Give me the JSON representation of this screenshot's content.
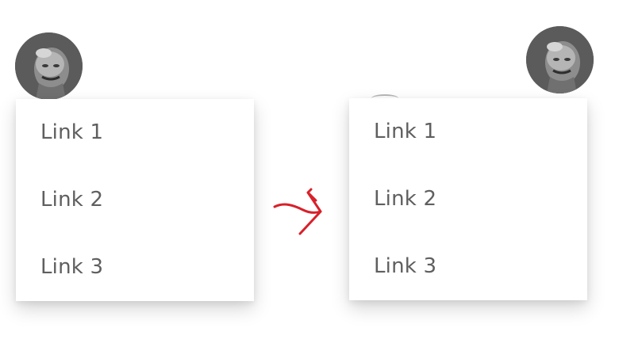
{
  "panels": {
    "before": {
      "menu": {
        "items": [
          {
            "label": "Link 1"
          },
          {
            "label": "Link 2"
          },
          {
            "label": "Link 3"
          }
        ]
      }
    },
    "after": {
      "menu": {
        "items": [
          {
            "label": "Link 1"
          },
          {
            "label": "Link 2"
          },
          {
            "label": "Link 3"
          }
        ]
      }
    }
  },
  "colors": {
    "menu_text": "#5f5f5f",
    "avatar_bg": "#5b5b5b",
    "arrow": "#d8202a"
  },
  "icons": {
    "avatar": "user-avatar-photo",
    "arrow": "hand-drawn-arrow-right-icon"
  }
}
